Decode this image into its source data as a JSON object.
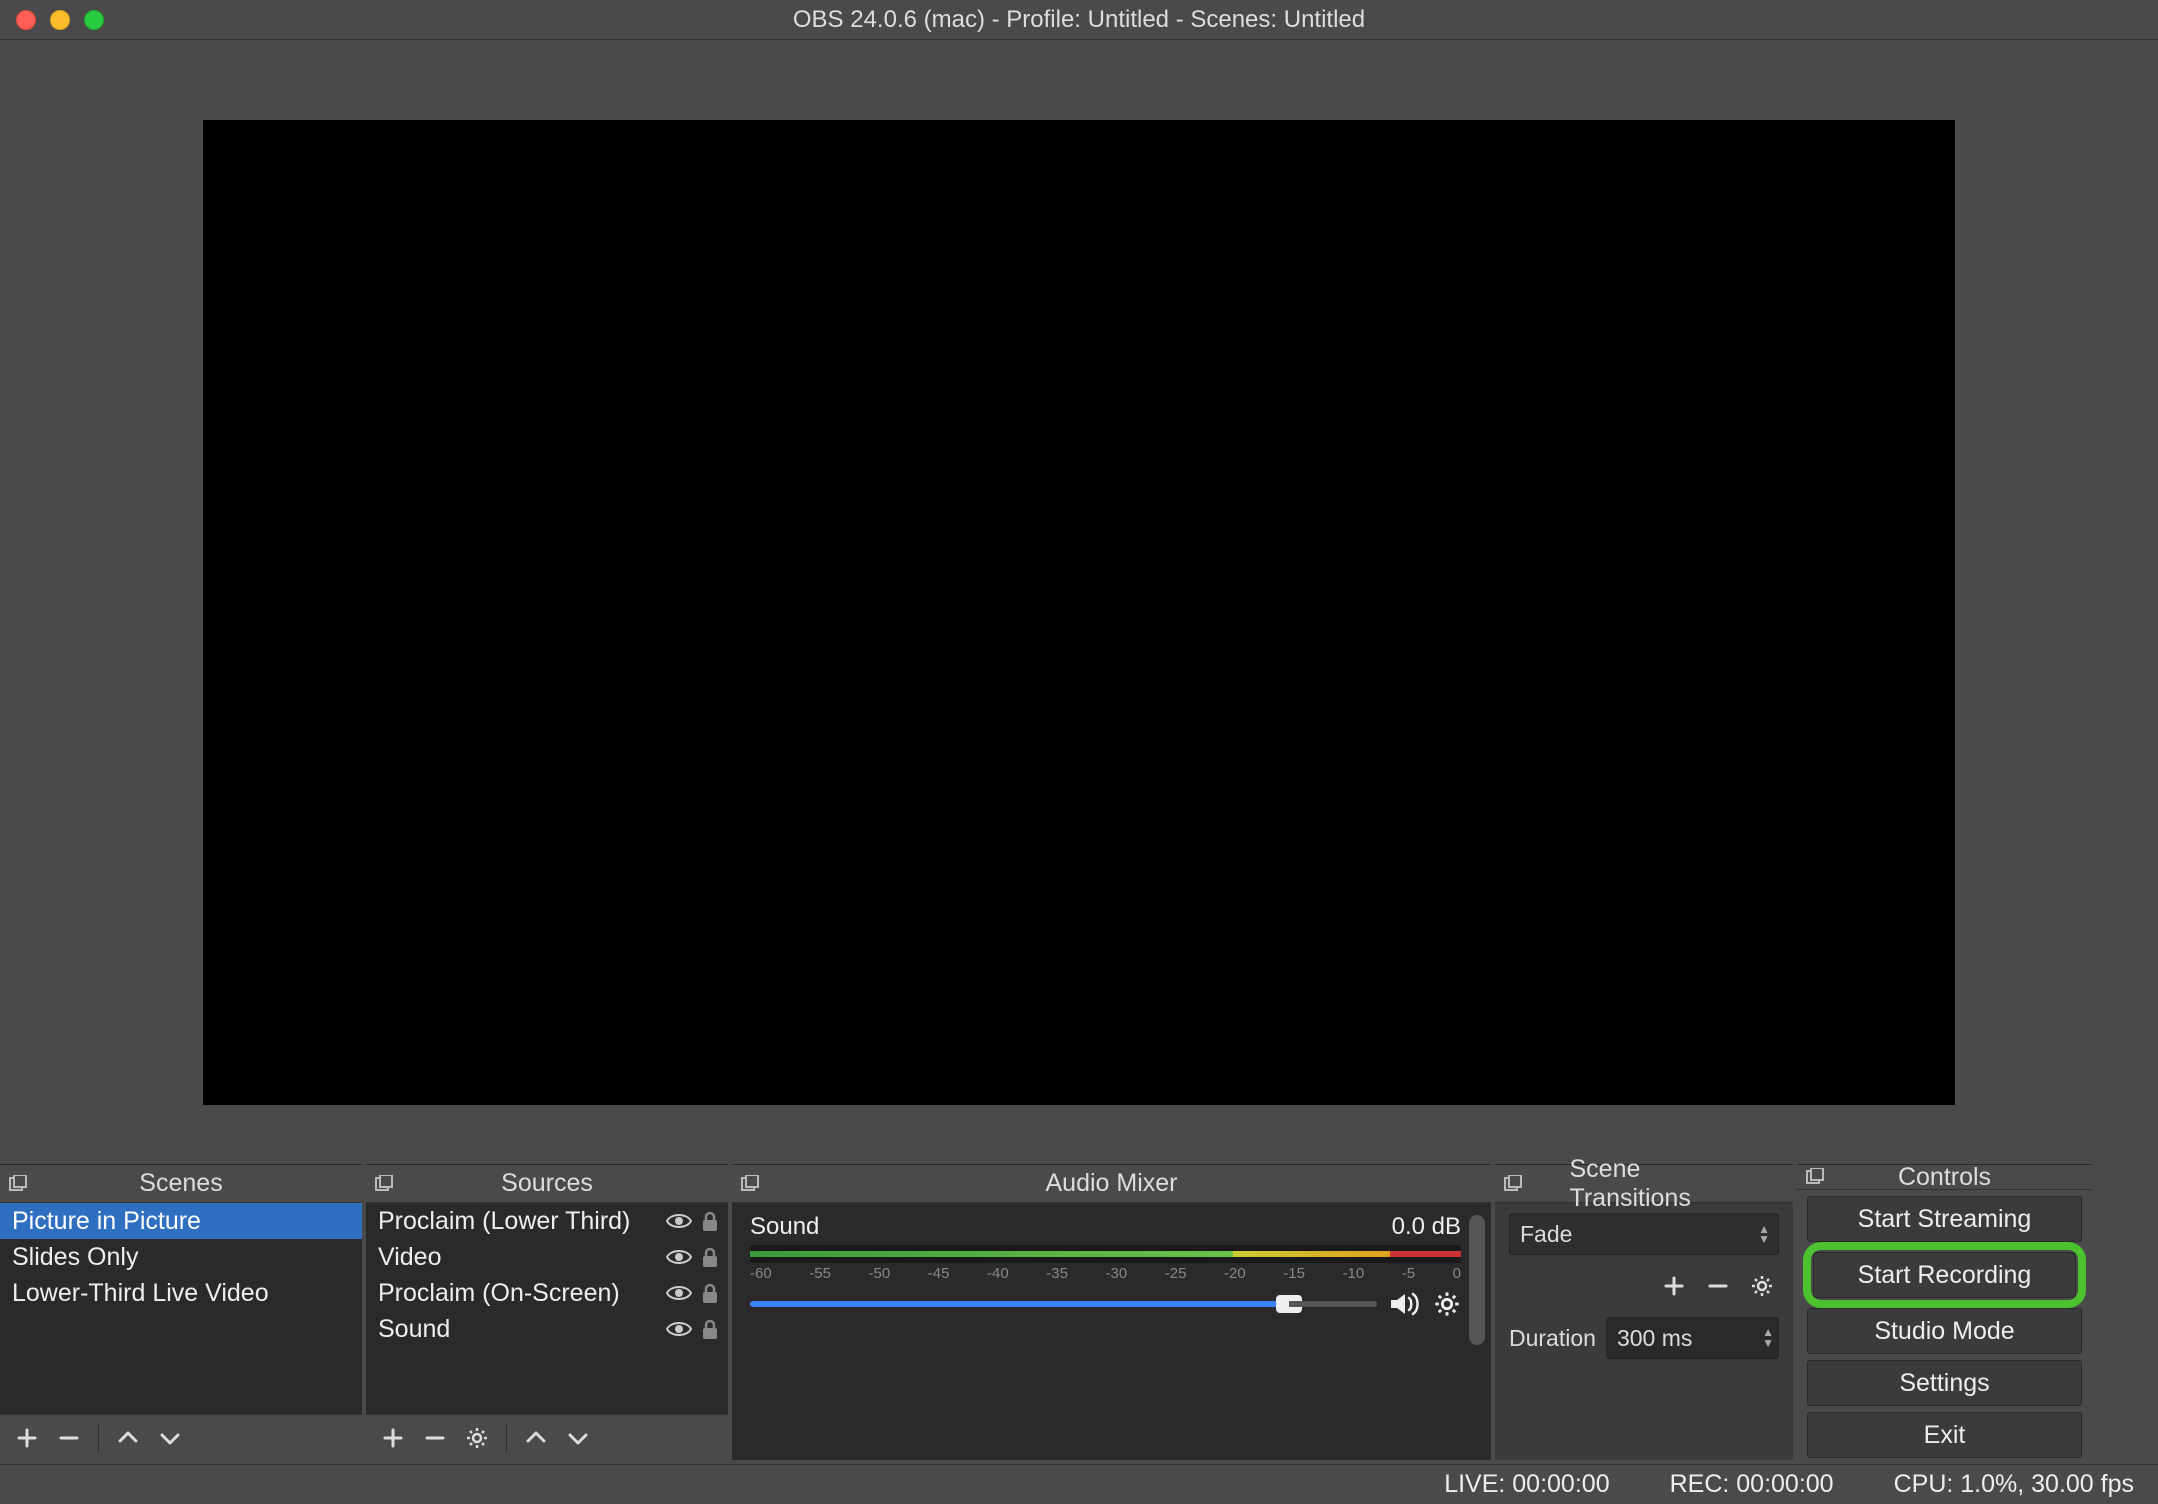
{
  "titlebar": {
    "title": "OBS 24.0.6 (mac) - Profile: Untitled - Scenes: Untitled"
  },
  "docks": {
    "scenes": {
      "title": "Scenes",
      "items": [
        "Picture in Picture",
        "Slides Only",
        "Lower-Third Live Video"
      ],
      "selected_index": 0
    },
    "sources": {
      "title": "Sources",
      "items": [
        "Proclaim (Lower Third)",
        "Video",
        "Proclaim (On-Screen)",
        "Sound"
      ]
    },
    "mixer": {
      "title": "Audio Mixer",
      "channel_name": "Sound",
      "channel_db": "0.0 dB",
      "ticks": [
        "-60",
        "-55",
        "-50",
        "-45",
        "-40",
        "-35",
        "-30",
        "-25",
        "-20",
        "-15",
        "-10",
        "-5",
        "0"
      ]
    },
    "transitions": {
      "title": "Scene Transitions",
      "selected": "Fade",
      "duration_label": "Duration",
      "duration_value": "300 ms"
    },
    "controls": {
      "title": "Controls",
      "buttons": [
        "Start Streaming",
        "Start Recording",
        "Studio Mode",
        "Settings",
        "Exit"
      ],
      "highlight_index": 1
    }
  },
  "statusbar": {
    "live": "LIVE: 00:00:00",
    "rec": "REC: 00:00:00",
    "cpu": "CPU: 1.0%, 30.00 fps"
  }
}
